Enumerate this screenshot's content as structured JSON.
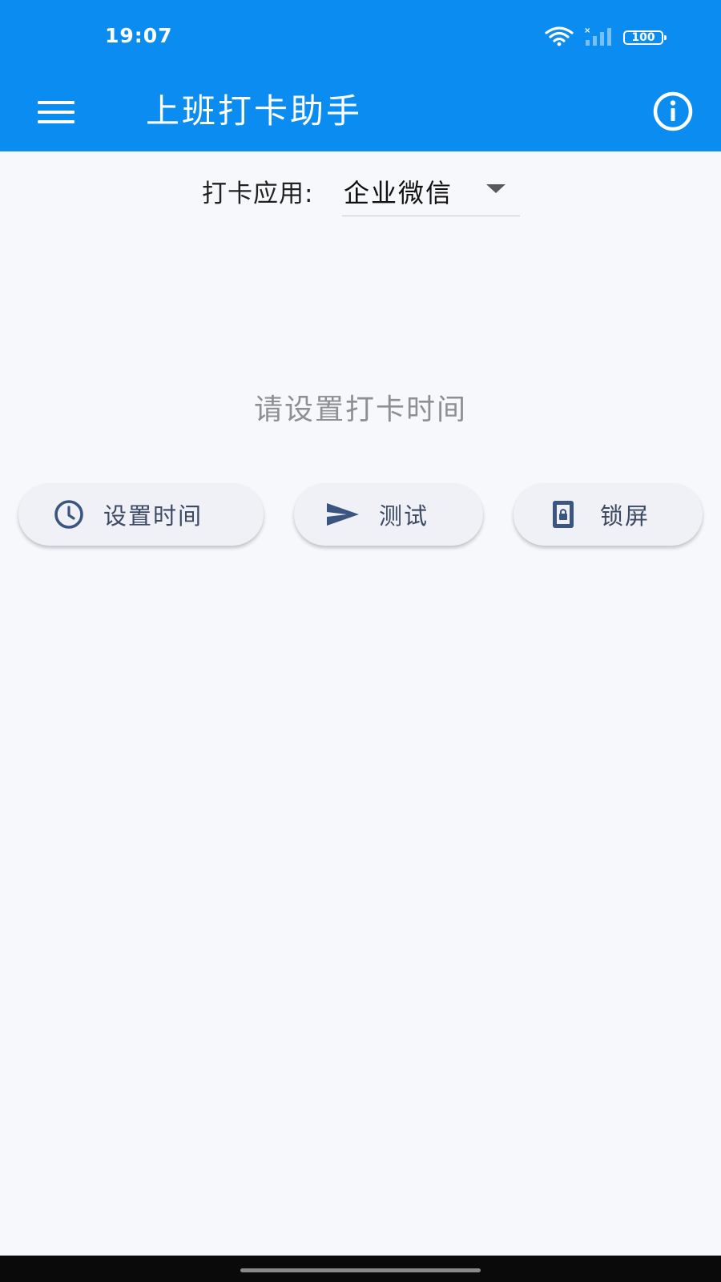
{
  "status_bar": {
    "time": "19:07",
    "battery_level": "100",
    "icons": [
      "wifi-icon",
      "cellular-signal-icon",
      "battery-icon"
    ]
  },
  "app_bar": {
    "title": "上班打卡助手",
    "left_icon": "menu-icon",
    "right_icon": "info-icon"
  },
  "selector": {
    "label": "打卡应用:",
    "value": "企业微信",
    "arrow_icon": "dropdown-arrow-icon"
  },
  "hint": "请设置打卡时间",
  "buttons": [
    {
      "label": "设置时间",
      "icon": "clock-icon"
    },
    {
      "label": "测试",
      "icon": "send-icon"
    },
    {
      "label": "锁屏",
      "icon": "lock-screen-icon"
    }
  ],
  "colors": {
    "app_bar": "#0b8cf0",
    "background": "#f7f8fc",
    "button_bg": "#f0f1f6",
    "icon": "#3a5580",
    "hint_text": "#8e8e93"
  }
}
